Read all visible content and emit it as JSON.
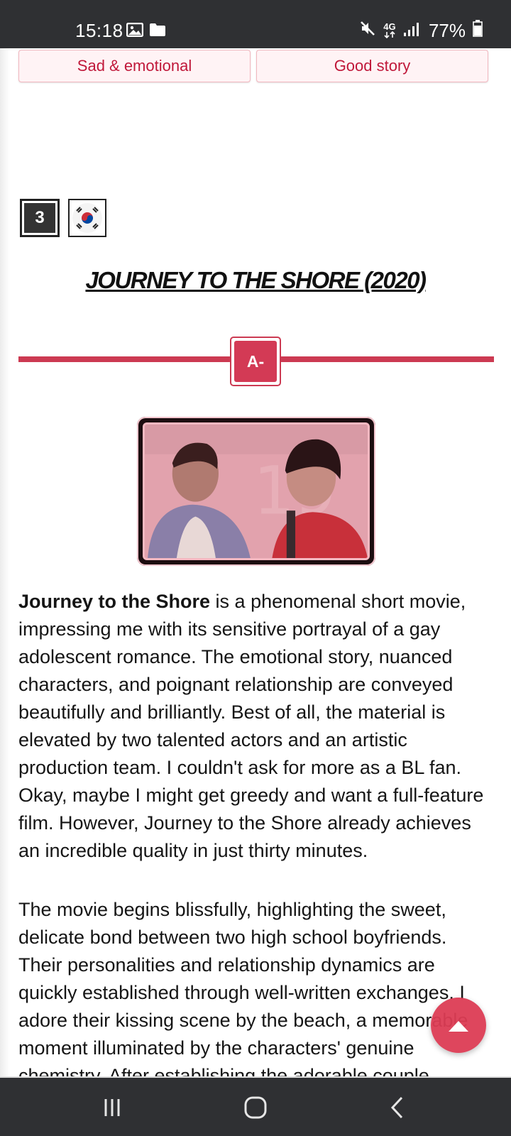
{
  "status_bar": {
    "time": "15:18",
    "network": "4G",
    "battery": "77%",
    "icons": [
      "image-icon",
      "folder-icon",
      "mute-icon",
      "data-4g-icon",
      "signal-icon",
      "battery-icon"
    ]
  },
  "tags": [
    "Sad & emotional",
    "Good story"
  ],
  "entry": {
    "rank": "3",
    "country_flag_icon": "south-korea-flag-icon",
    "title": "JOURNEY TO THE SHORE (2020)",
    "grade": "A-"
  },
  "article": {
    "p1_bold": "Journey to the Shore",
    "p1_rest": " is a phenomenal short movie, impressing me with its sensitive portrayal of a gay adolescent romance. The emotional story, nuanced characters, and poignant relationship are conveyed beautifully and brilliantly. Best of all, the material is elevated by two talented actors and an artistic production team. I couldn't ask for more as a BL fan. Okay, maybe I might get greedy and want a full-feature film. However, Journey to the Shore already achieves an incredible quality in just thirty minutes.",
    "p2": "The movie begins blissfully, highlighting the sweet, delicate bond between two high school boyfriends. Their personalities and relationship dynamics are quickly established through well-written exchanges. I adore their kissing scene by the beach, a memorable moment illuminated by the characters' genuine chemistry. After establishing the adorable couple"
  },
  "colors": {
    "accent": "#d33a55",
    "tag_text": "#c0183a",
    "tag_bg": "#fff3f5",
    "system_bar": "#2f3033"
  },
  "nav": {
    "icons": [
      "recent-apps-icon",
      "home-icon",
      "back-icon"
    ]
  }
}
